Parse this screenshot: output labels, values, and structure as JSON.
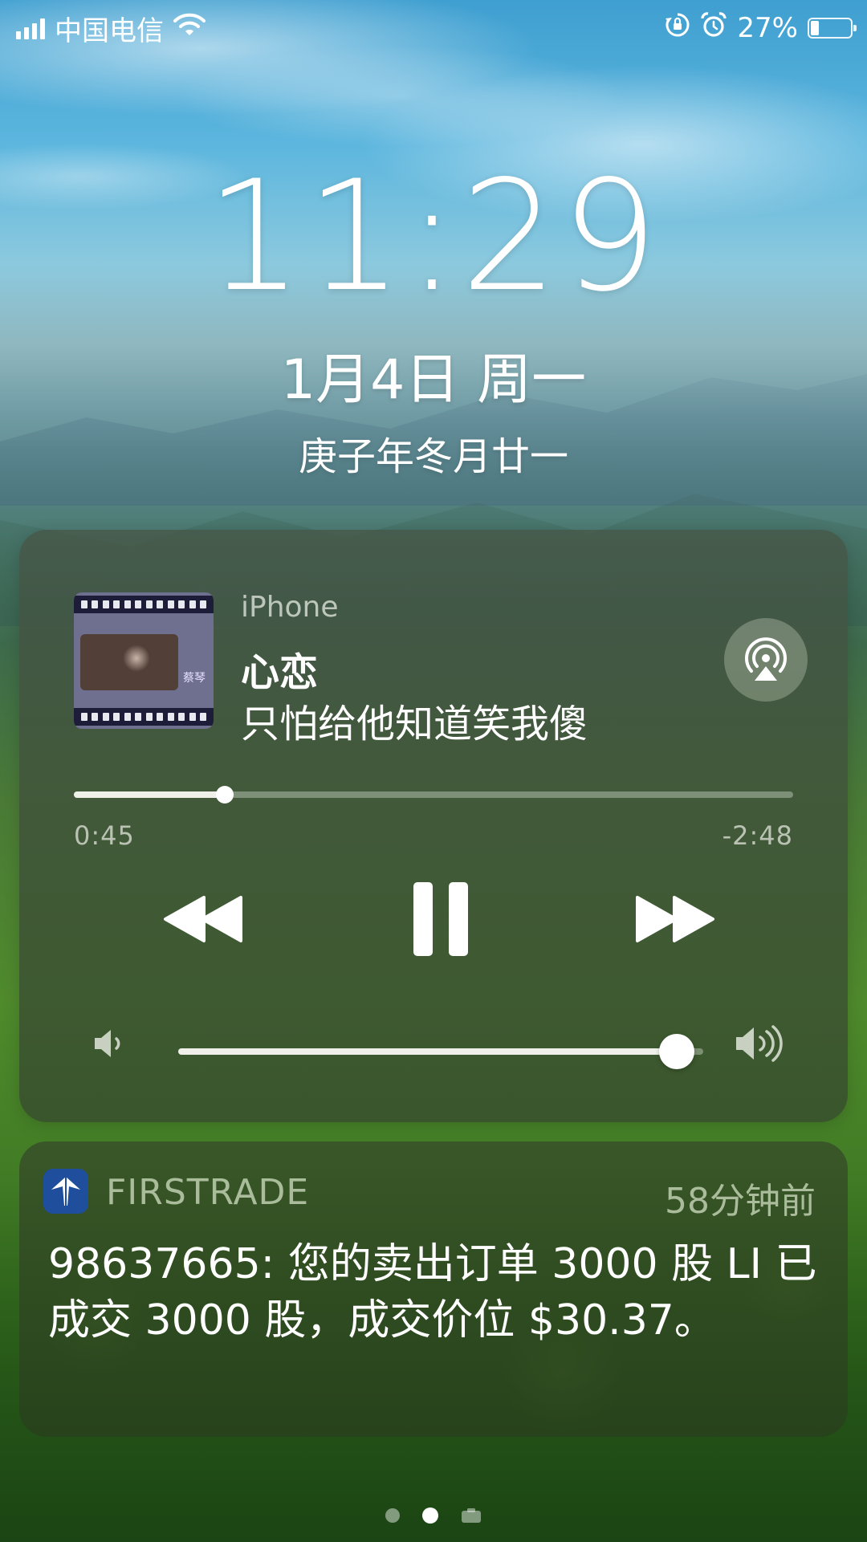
{
  "status_bar": {
    "carrier": "中国电信",
    "battery_percent": "27%",
    "battery_level": 0.27,
    "icons": [
      "signal-icon",
      "wifi-icon",
      "orientation-lock-icon",
      "alarm-icon",
      "battery-icon"
    ]
  },
  "lock_screen": {
    "time": "11:29",
    "date": "1月4日 周一",
    "lunar_date": "庚子年冬月廿一"
  },
  "now_playing": {
    "source": "iPhone",
    "title": "心恋",
    "artist": "只怕给他知道笑我傻",
    "artwork_caption": "蔡琴",
    "elapsed": "0:45",
    "remaining": "-2:48",
    "progress": 0.21,
    "volume": 0.95,
    "controls": [
      "rewind-icon",
      "pause-icon",
      "fast-forward-icon"
    ],
    "airplay_icon": "airplay-icon"
  },
  "notification": {
    "app_name": "FIRSTRADE",
    "time_ago": "58分钟前",
    "body": "98637665: 您的卖出订单 3000 股 LI 已成交 3000 股，成交价位 $30.37。",
    "icon": "firstrade-app-icon",
    "icon_color": "#1f4f9c"
  },
  "page_indicator": {
    "pages": 3,
    "active_index": 1
  }
}
